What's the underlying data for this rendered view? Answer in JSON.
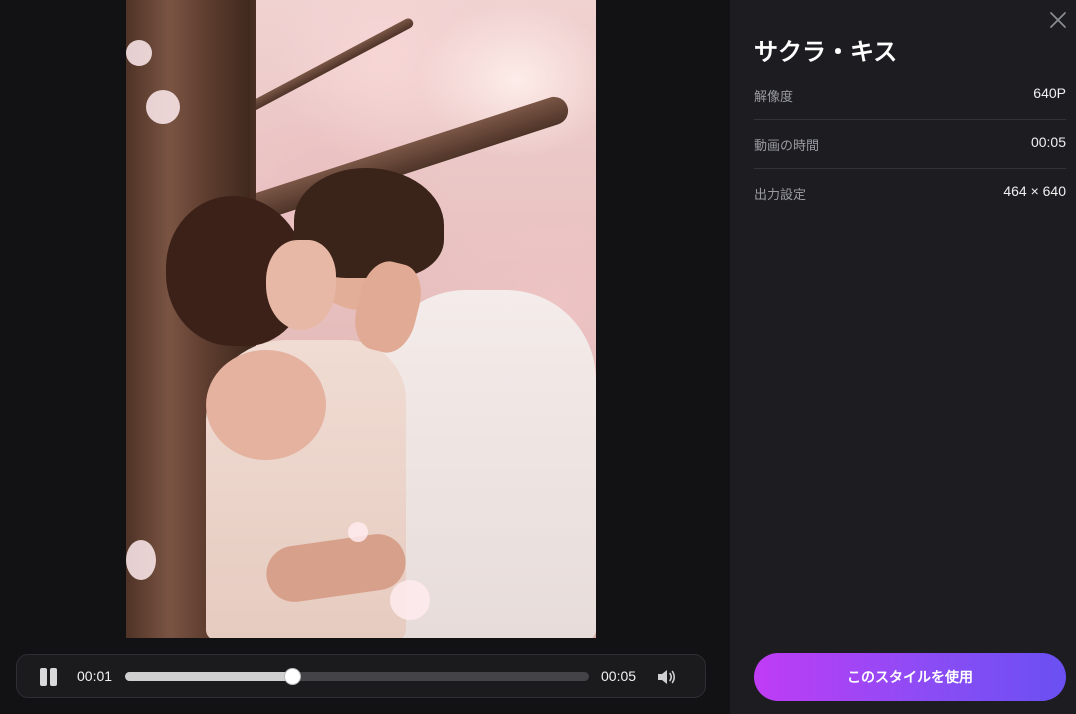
{
  "player": {
    "current_time": "00:01",
    "total_time": "00:05",
    "progress": 0.36
  },
  "panel": {
    "title": "サクラ・キス",
    "rows": [
      {
        "label": "解像度",
        "value": "640P"
      },
      {
        "label": "動画の時間",
        "value": "00:05"
      },
      {
        "label": "出力設定",
        "value": "464 × 640"
      }
    ],
    "use_button_label": "このスタイルを使用"
  },
  "colors": {
    "background": "#121214",
    "panel": "#1c1c21",
    "button_gradient_start": "#c03cf5",
    "button_gradient_end": "#6a50f2"
  },
  "icons": {
    "pause": "pause-icon",
    "volume": "volume-icon",
    "close": "close-icon"
  }
}
